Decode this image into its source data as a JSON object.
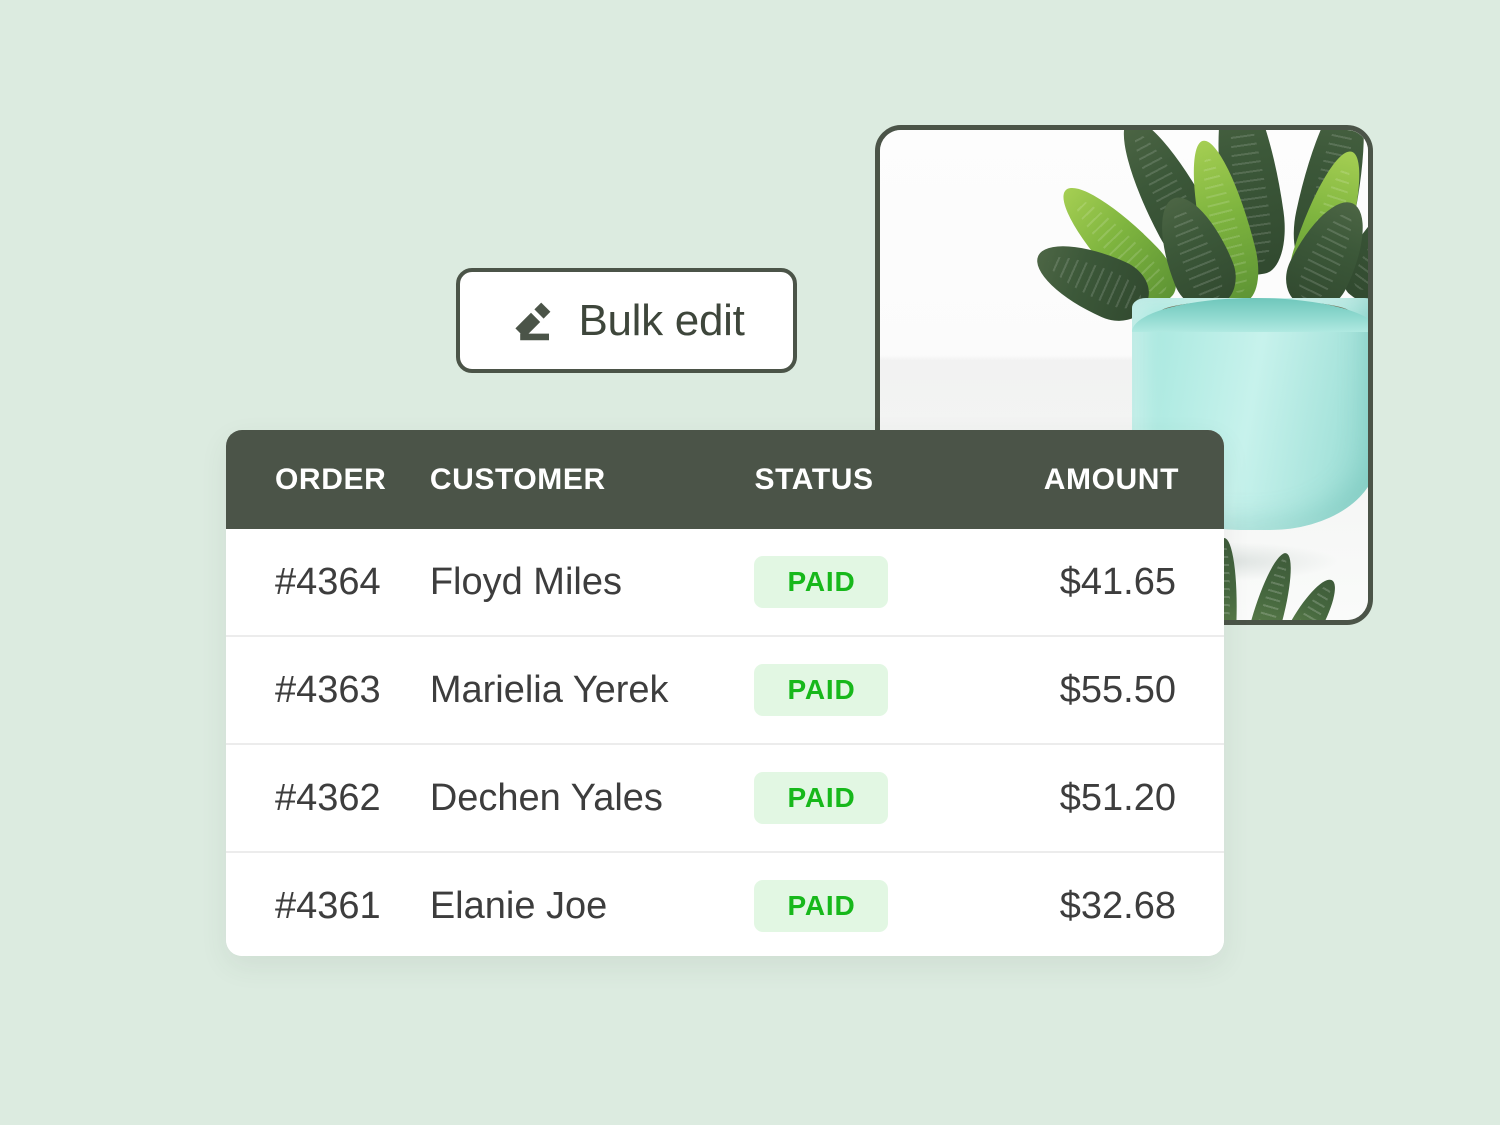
{
  "background_color": "#dcebe0",
  "toolbar": {
    "bulk_edit_label": "Bulk edit",
    "bulk_edit_icon": "pencil-edit-icon"
  },
  "product_image": {
    "alt": "potted succulent plant in mint green pot",
    "pot_color": "#b4ece4",
    "leaf_color": "#3c5839"
  },
  "orders_table": {
    "columns": [
      "ORDER",
      "CUSTOMER",
      "STATUS",
      "AMOUNT"
    ],
    "header_bg": "#4b5448",
    "header_text_color": "#ffffff",
    "badge_bg": "#e2f7e3",
    "badge_text_color": "#17b81b",
    "rows": [
      {
        "order": "#4364",
        "customer": "Floyd Miles",
        "status": "PAID",
        "amount": "$41.65"
      },
      {
        "order": "#4363",
        "customer": "Marielia Yerek",
        "status": "PAID",
        "amount": "$55.50"
      },
      {
        "order": "#4362",
        "customer": "Dechen Yales",
        "status": "PAID",
        "amount": "$51.20"
      },
      {
        "order": "#4361",
        "customer": "Elanie Joe",
        "status": "PAID",
        "amount": "$32.68"
      }
    ]
  }
}
